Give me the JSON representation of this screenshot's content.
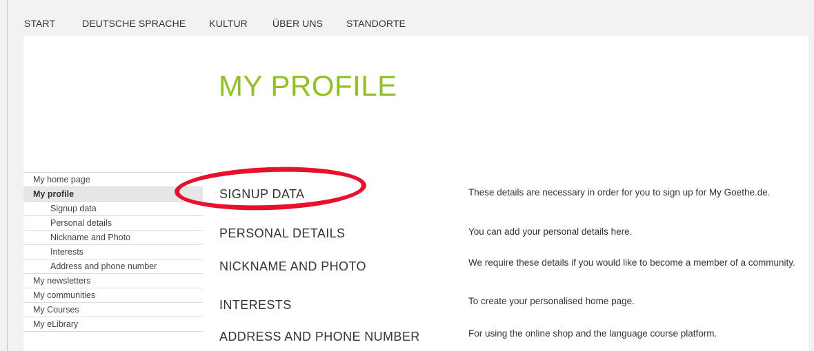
{
  "top_nav": [
    "START",
    "DEUTSCHE SPRACHE",
    "KULTUR",
    "ÜBER UNS",
    "STANDORTE"
  ],
  "page_title": "MY PROFILE",
  "sidebar": {
    "items": [
      {
        "label": "My home page"
      },
      {
        "label": "My profile"
      },
      {
        "label": "Signup data"
      },
      {
        "label": "Personal details"
      },
      {
        "label": "Nickname and Photo"
      },
      {
        "label": "Interests"
      },
      {
        "label": "Address and phone number"
      },
      {
        "label": "My newsletters"
      },
      {
        "label": "My communities"
      },
      {
        "label": "My Courses"
      },
      {
        "label": "My eLibrary"
      }
    ]
  },
  "sections": [
    {
      "title": "SIGNUP DATA",
      "description": "These details are necessary in order for you to sign up for My Goethe.de."
    },
    {
      "title": "PERSONAL DETAILS",
      "description": "You can add your personal details here."
    },
    {
      "title": "NICKNAME AND PHOTO",
      "description": "We require these details if you would like to become a member of a community."
    },
    {
      "title": "INTERESTS",
      "description": "To create your personalised home page."
    },
    {
      "title": "ADDRESS AND PHONE NUMBER",
      "description": "For using the online shop and the language course platform."
    }
  ],
  "colors": {
    "title_green": "#8fc21f",
    "highlight_red": "#e8102a"
  }
}
